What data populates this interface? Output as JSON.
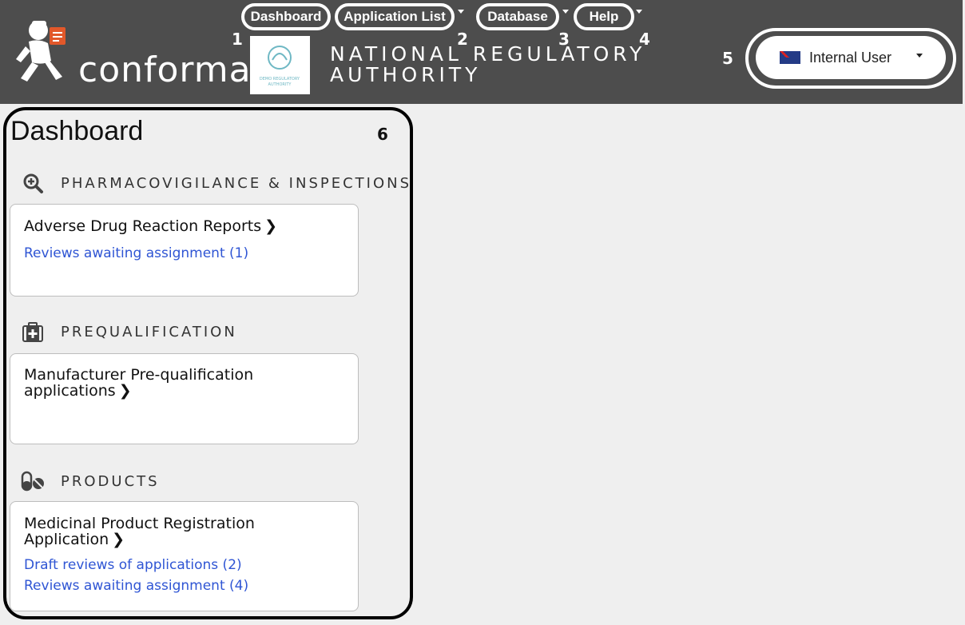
{
  "header": {
    "brand": "conforma",
    "org_title_line1": "NATIONAL REGULATORY",
    "org_title_line2": "AUTHORITY",
    "badge_text": "DEMO REGULATORY AUTHORITY",
    "bg_color": "#4d4d4d"
  },
  "nav": {
    "items": [
      {
        "label": "Dashboard",
        "num": "1"
      },
      {
        "label": "Application List",
        "num": "2"
      },
      {
        "label": "Database",
        "num": "3"
      },
      {
        "label": "Help",
        "num": "4"
      }
    ]
  },
  "user_menu": {
    "label": "Internal User",
    "num": "5",
    "flag_icon": "nz-flag-icon"
  },
  "dashboard": {
    "title": "Dashboard",
    "num": "6",
    "sections": [
      {
        "label": "PHARMACOVIGILANCE & INSPECTIONS",
        "icon": "magnify-plus-icon",
        "card": {
          "title": "Adverse Drug Reaction Reports",
          "links": [
            "Reviews awaiting assignment (1)"
          ]
        }
      },
      {
        "label": "PREQUALIFICATION",
        "icon": "medkit-icon",
        "card": {
          "title_line1": "Manufacturer Pre-qualification",
          "title_line2": "applications",
          "links": []
        }
      },
      {
        "label": "PRODUCTS",
        "icon": "pills-icon",
        "card": {
          "title_line1": "Medicinal Product Registration",
          "title_line2": "Application",
          "links": [
            "Draft reviews of applications (2)",
            "Reviews awaiting assignment (4)"
          ]
        }
      }
    ],
    "link_color": "#2f55d4"
  }
}
